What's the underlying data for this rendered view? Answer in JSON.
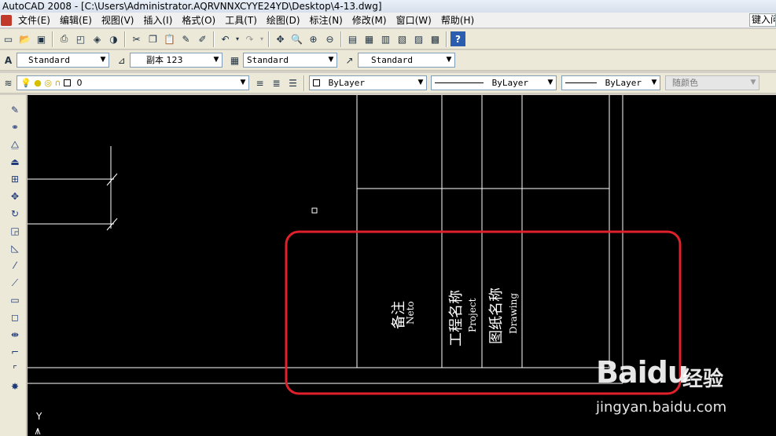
{
  "window": {
    "title": "AutoCAD 2008 - [C:\\Users\\Administrator.AQRVNNXCYYE24YD\\Desktop\\4-13.dwg]"
  },
  "menu": {
    "items": [
      "文件(E)",
      "编辑(E)",
      "视图(V)",
      "插入(I)",
      "格式(O)",
      "工具(T)",
      "绘图(D)",
      "标注(N)",
      "修改(M)",
      "窗口(W)",
      "帮助(H)"
    ],
    "search_text": "键入问"
  },
  "styles_toolbar": {
    "text_style": "Standard",
    "dim_style": "副本 123",
    "table_style": "Standard",
    "multileader_style": "Standard"
  },
  "layers_toolbar": {
    "layer": "0"
  },
  "properties_toolbar": {
    "color": "ByLayer",
    "linetype": "ByLayer",
    "lineweight": "ByLayer",
    "plot_style": "随颜色"
  },
  "drawing": {
    "cells": [
      {
        "cn": "备注",
        "en": "Neto"
      },
      {
        "cn": "工程名称",
        "en": "Project"
      },
      {
        "cn": "图纸名称",
        "en": "Drawing"
      }
    ],
    "ucs_label": "Y"
  },
  "watermark": {
    "logo_text": "Bai",
    "logo_suffix": "du",
    "cn_text": "经验",
    "url": "jingyan.baidu.com"
  },
  "colors": {
    "canvas": "#000000",
    "line": "#ffffff",
    "highlight": "#e0202a"
  }
}
